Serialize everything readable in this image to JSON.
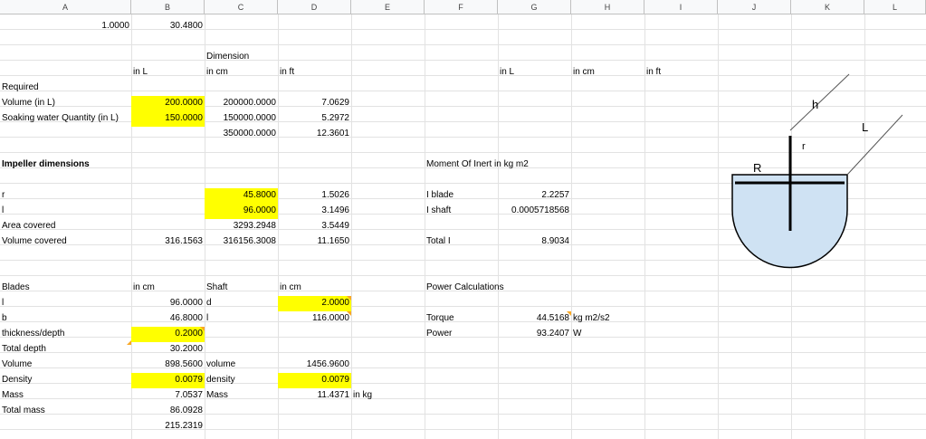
{
  "columns": [
    "A",
    "B",
    "C",
    "D",
    "E",
    "F",
    "G",
    "H",
    "I",
    "J",
    "K",
    "L"
  ],
  "cells": {
    "A2": "1.0000",
    "B2": "30.4800",
    "C4": "Dimension",
    "B5": "in L",
    "C5": "in cm",
    "D5": "in ft",
    "G5": "in L",
    "H5": "in cm",
    "I5": "in ft",
    "A6": "Required",
    "A7": "Volume (in L)",
    "B7": "200.0000",
    "C7": "200000.0000",
    "D7": "7.0629",
    "A8": "Soaking water Quantity (in L)",
    "B8": "150.0000",
    "C8": "150000.0000",
    "D8": "5.2972",
    "C9": "350000.0000",
    "D9": "12.3601",
    "A11": "Impeller dimensions",
    "F11": "Moment Of Inert in kg m2",
    "A13": "r",
    "C13": "45.8000",
    "D13": "1.5026",
    "F13": "I blade",
    "G13": "2.2257",
    "A14": "l",
    "C14": "96.0000",
    "D14": "3.1496",
    "F14": "I shaft",
    "G14": "0.0005718568",
    "A15": "Area covered",
    "C15": "3293.2948",
    "D15": "3.5449",
    "A16": "Volume covered",
    "B16": "316.1563",
    "C16": "316156.3008",
    "D16": "11.1650",
    "F16": "Total I",
    "G16": "8.9034",
    "A19": "Blades",
    "B19": "in cm",
    "C19": "Shaft",
    "D19": "in cm",
    "F19": "Power Calculations",
    "A20": "l",
    "B20": "96.0000",
    "C20": "d",
    "D20": "2.0000",
    "A21": "b",
    "B21": "46.8000",
    "C21": "l",
    "D21": "116.0000",
    "F21": "Torque",
    "G21": "44.5168",
    "H21": "kg m2/s2",
    "A22": "thickness/depth",
    "B22": "0.2000",
    "F22": "Power",
    "G22": "93.2407",
    "H22": "W",
    "A23": "Total depth",
    "B23": "30.2000",
    "A24": "Volume",
    "B24": "898.5600",
    "C24": "volume",
    "D24": "1456.9600",
    "A25": "Density",
    "B25": "0.0079",
    "C25": "density",
    "D25": "0.0079",
    "A26": "Mass",
    "B26": "7.0537",
    "C26": "Mass",
    "D26": "11.4371",
    "E26": "in kg",
    "A27": "Total mass",
    "B27": "86.0928",
    "B28": "215.2319"
  },
  "diagram": {
    "label_h": "h",
    "label_L": "L",
    "label_r": "r",
    "label_R": "R",
    "fill_color": "#cfe2f3"
  },
  "colors": {
    "highlight": "#ffff00",
    "header_bg": "#f8f9fa",
    "gridline": "#e2e2e2"
  }
}
